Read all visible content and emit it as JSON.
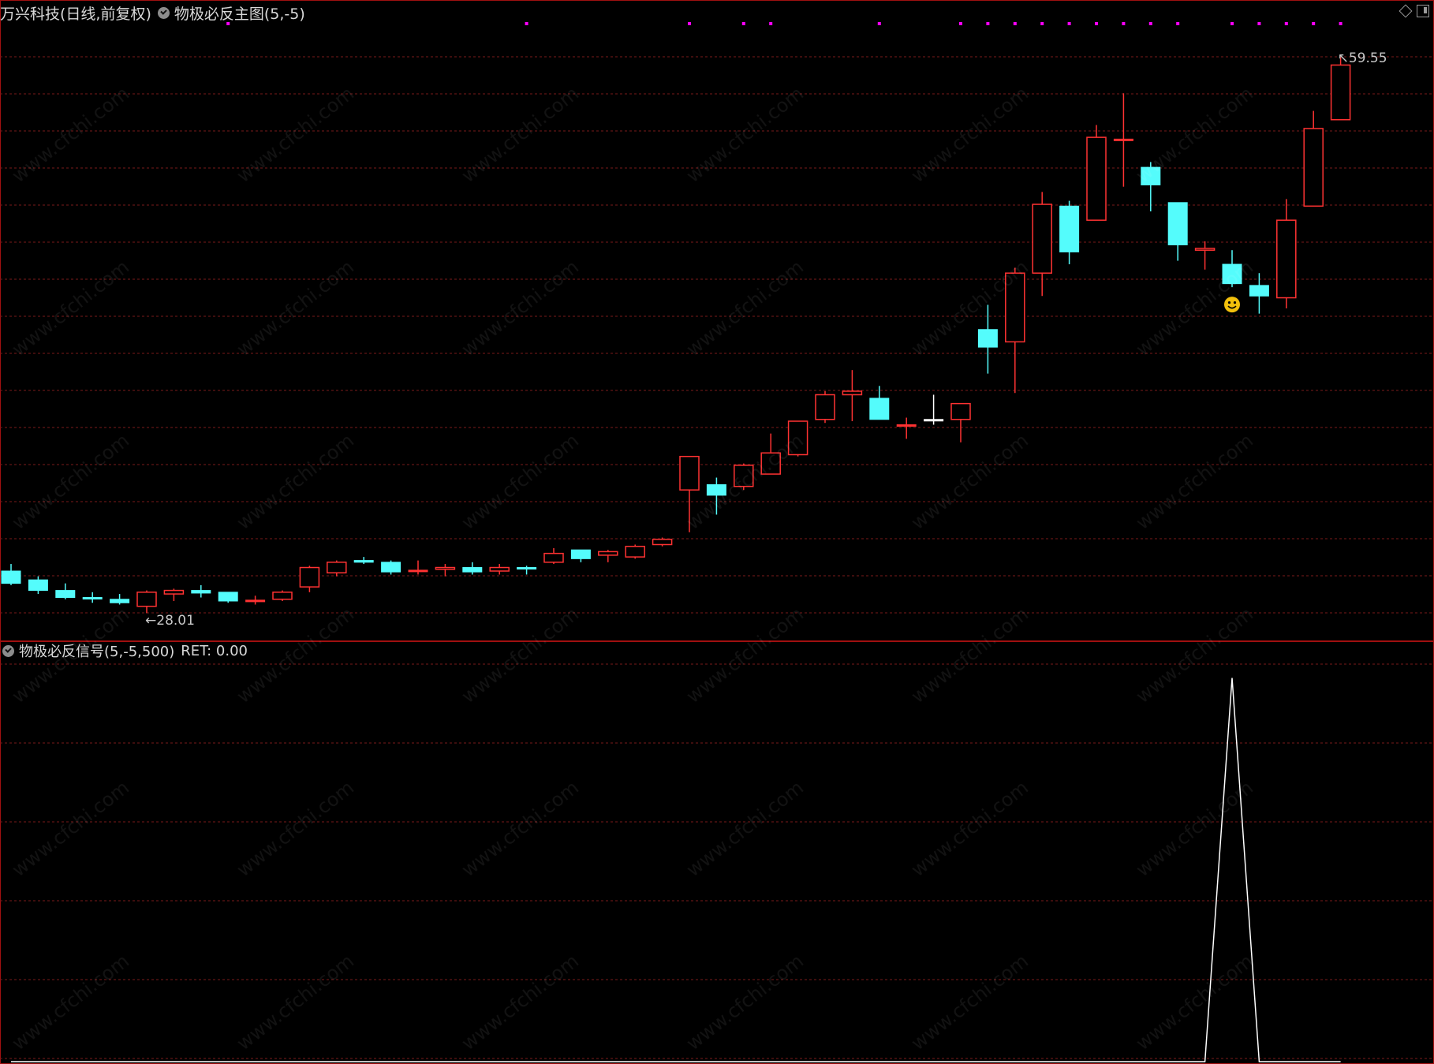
{
  "header": {
    "stock_label": "万兴科技(日线,前复权)",
    "indicator_label": "物极必反主图(5,-5)"
  },
  "sub_header": {
    "indicator_label": "物极必反信号(5,-5,500)",
    "ret_label": "RET: 0.00"
  },
  "price_labels": {
    "high": "59.55",
    "low": "28.01"
  },
  "watermark_text": "www.cfchi.com",
  "colors": {
    "up": "#ff3232",
    "down": "#54fcfc",
    "doji": "#ffffff",
    "grid": "#7a1a1a",
    "separator": "#a01010",
    "marker": "#ff00ff",
    "signal_line": "#ffffff",
    "smiley": "#f2c00c"
  },
  "chart_data": [
    {
      "type": "candlestick",
      "title": "物极必反主图(5,-5)",
      "ylim": [
        27,
        61
      ],
      "grid": true,
      "annotations": [
        {
          "text": "28.01",
          "candle": 5,
          "kind": "lowest"
        },
        {
          "text": "59.55",
          "candle": 49,
          "kind": "highest"
        },
        {
          "kind": "smiley",
          "candle": 45
        }
      ],
      "top_markers": [
        8,
        19,
        25,
        27,
        28,
        32,
        35,
        36,
        37,
        38,
        39,
        40,
        41,
        42,
        43,
        45,
        46,
        47,
        48,
        49
      ],
      "candles": [
        {
          "o": 30.4,
          "h": 30.8,
          "l": 29.6,
          "c": 29.7
        },
        {
          "o": 29.9,
          "h": 30.1,
          "l": 29.1,
          "c": 29.3
        },
        {
          "o": 29.3,
          "h": 29.7,
          "l": 28.8,
          "c": 28.9
        },
        {
          "o": 28.9,
          "h": 29.2,
          "l": 28.6,
          "c": 28.85
        },
        {
          "o": 28.8,
          "h": 29.1,
          "l": 28.5,
          "c": 28.6
        },
        {
          "o": 28.4,
          "h": 29.3,
          "l": 28.01,
          "c": 29.2
        },
        {
          "o": 29.1,
          "h": 29.4,
          "l": 28.7,
          "c": 29.3
        },
        {
          "o": 29.3,
          "h": 29.6,
          "l": 28.9,
          "c": 29.15
        },
        {
          "o": 29.2,
          "h": 29.2,
          "l": 28.6,
          "c": 28.7
        },
        {
          "o": 28.7,
          "h": 29.0,
          "l": 28.5,
          "c": 28.75
        },
        {
          "o": 28.8,
          "h": 29.3,
          "l": 28.7,
          "c": 29.2
        },
        {
          "o": 29.5,
          "h": 30.7,
          "l": 29.2,
          "c": 30.6
        },
        {
          "o": 30.3,
          "h": 31.0,
          "l": 30.1,
          "c": 30.9
        },
        {
          "o": 31.0,
          "h": 31.2,
          "l": 30.8,
          "c": 30.9
        },
        {
          "o": 30.9,
          "h": 31.0,
          "l": 30.2,
          "c": 30.35
        },
        {
          "o": 30.4,
          "h": 31.0,
          "l": 30.2,
          "c": 30.45
        },
        {
          "o": 30.5,
          "h": 30.8,
          "l": 30.1,
          "c": 30.6
        },
        {
          "o": 30.6,
          "h": 30.9,
          "l": 30.2,
          "c": 30.35
        },
        {
          "o": 30.4,
          "h": 30.8,
          "l": 30.2,
          "c": 30.6
        },
        {
          "o": 30.6,
          "h": 30.7,
          "l": 30.2,
          "c": 30.55
        },
        {
          "o": 30.9,
          "h": 31.7,
          "l": 30.8,
          "c": 31.4
        },
        {
          "o": 31.6,
          "h": 31.6,
          "l": 30.9,
          "c": 31.1
        },
        {
          "o": 31.3,
          "h": 31.6,
          "l": 30.9,
          "c": 31.5
        },
        {
          "o": 31.2,
          "h": 31.9,
          "l": 31.1,
          "c": 31.8
        },
        {
          "o": 31.9,
          "h": 32.3,
          "l": 31.8,
          "c": 32.2
        },
        {
          "o": 35.0,
          "h": 35.7,
          "l": 32.6,
          "c": 36.9
        },
        {
          "o": 35.3,
          "h": 35.7,
          "l": 33.6,
          "c": 34.7
        },
        {
          "o": 35.2,
          "h": 36.5,
          "l": 35.0,
          "c": 36.4
        },
        {
          "o": 35.9,
          "h": 38.2,
          "l": 35.9,
          "c": 37.1
        },
        {
          "o": 37.0,
          "h": 38.3,
          "l": 36.9,
          "c": 38.9
        },
        {
          "o": 39.0,
          "h": 40.6,
          "l": 38.8,
          "c": 40.4
        },
        {
          "o": 40.4,
          "h": 41.8,
          "l": 38.9,
          "c": 40.6
        },
        {
          "o": 40.2,
          "h": 40.9,
          "l": 39.0,
          "c": 39.0
        },
        {
          "o": 38.7,
          "h": 39.1,
          "l": 37.9,
          "c": 38.7
        },
        {
          "o": 39.0,
          "h": 40.4,
          "l": 38.7,
          "c": 39.0
        },
        {
          "o": 39.0,
          "h": 39.9,
          "l": 37.7,
          "c": 39.9
        },
        {
          "o": 44.1,
          "h": 45.5,
          "l": 41.6,
          "c": 43.1
        },
        {
          "o": 43.4,
          "h": 47.6,
          "l": 40.5,
          "c": 47.3
        },
        {
          "o": 47.3,
          "h": 51.9,
          "l": 46.0,
          "c": 51.2
        },
        {
          "o": 51.1,
          "h": 51.4,
          "l": 47.8,
          "c": 48.5
        },
        {
          "o": 50.3,
          "h": 55.7,
          "l": 50.3,
          "c": 55.0
        },
        {
          "o": 54.9,
          "h": 57.5,
          "l": 52.2,
          "c": 54.9
        },
        {
          "o": 53.3,
          "h": 53.6,
          "l": 50.8,
          "c": 52.3
        },
        {
          "o": 51.3,
          "h": 51.3,
          "l": 48.0,
          "c": 48.9
        },
        {
          "o": 48.6,
          "h": 49.1,
          "l": 47.5,
          "c": 48.7
        },
        {
          "o": 47.8,
          "h": 48.6,
          "l": 46.5,
          "c": 46.7
        },
        {
          "o": 46.6,
          "h": 47.3,
          "l": 45.0,
          "c": 46.0
        },
        {
          "o": 45.9,
          "h": 51.5,
          "l": 45.3,
          "c": 50.3
        },
        {
          "o": 51.1,
          "h": 56.5,
          "l": 51.1,
          "c": 55.5
        },
        {
          "o": 56.0,
          "h": 59.55,
          "l": 56.0,
          "c": 59.1
        }
      ]
    },
    {
      "type": "line",
      "title": "物极必反信号(5,-5,500)",
      "ylim": [
        0,
        520
      ],
      "grid": true,
      "values": [
        0,
        0,
        0,
        0,
        0,
        0,
        0,
        0,
        0,
        0,
        0,
        0,
        0,
        0,
        0,
        0,
        0,
        0,
        0,
        0,
        0,
        0,
        0,
        0,
        0,
        0,
        0,
        0,
        0,
        0,
        0,
        0,
        0,
        0,
        0,
        0,
        0,
        0,
        0,
        0,
        0,
        0,
        0,
        0,
        0,
        500,
        0,
        0,
        0,
        0
      ]
    }
  ]
}
